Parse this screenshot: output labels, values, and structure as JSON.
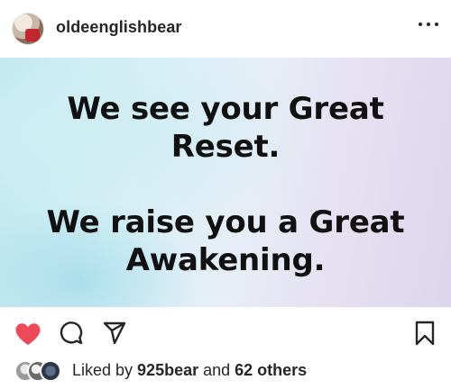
{
  "post": {
    "username": "oldeenglishbear",
    "image_text": {
      "line1a": "We see your Great",
      "line1b": "Reset.",
      "line2a": "We raise you a Great",
      "line2b": "Awakening."
    },
    "likes": {
      "prefix": "Liked by ",
      "user": "925bear",
      "middle": " and ",
      "others": "62 others"
    },
    "liked": true
  },
  "colors": {
    "like_red": "#ed4956",
    "text": "#262626"
  },
  "icons": {
    "more": "more-options-icon",
    "like": "heart-icon",
    "comment": "comment-icon",
    "share": "share-icon",
    "save": "bookmark-icon"
  }
}
